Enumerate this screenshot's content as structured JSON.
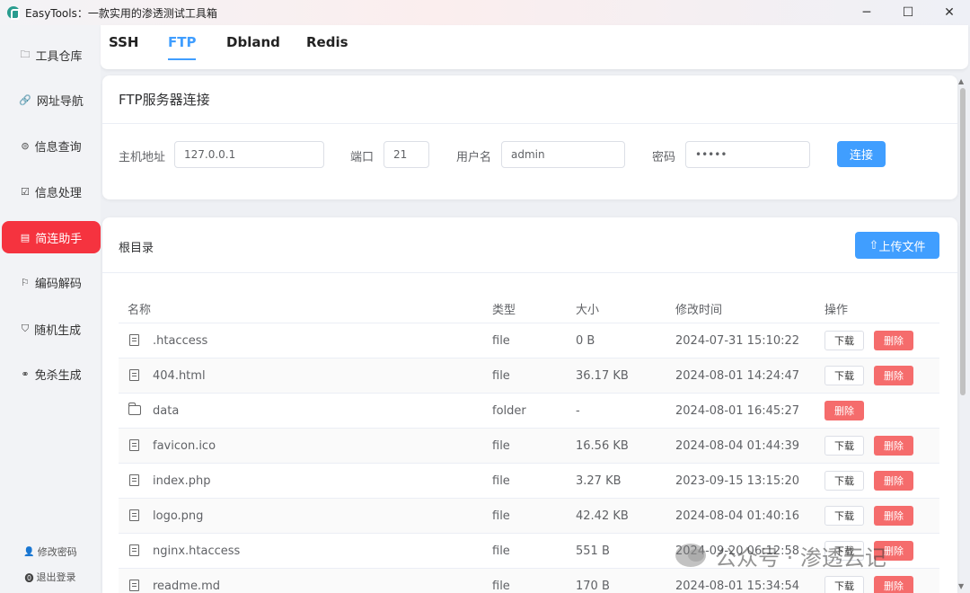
{
  "window": {
    "title": "EasyTools：一款实用的渗透测试工具箱",
    "controls": {
      "minimize": "─",
      "maximize": "☐",
      "close": "✕"
    }
  },
  "sidebar": {
    "items": [
      {
        "label": "工具仓库",
        "icon": "🗀"
      },
      {
        "label": "网址导航",
        "icon": "🔗"
      },
      {
        "label": "信息查询",
        "icon": "⊜"
      },
      {
        "label": "信息处理",
        "icon": "☑"
      },
      {
        "label": "简连助手",
        "icon": "▤",
        "active": true
      },
      {
        "label": "编码解码",
        "icon": "⚐"
      },
      {
        "label": "随机生成",
        "icon": "⛉"
      },
      {
        "label": "免杀生成",
        "icon": "⚭"
      }
    ],
    "footer": {
      "change_password": "修改密码",
      "change_password_icon": "👤",
      "logout": "退出登录",
      "logout_icon": "⓿"
    }
  },
  "tabs": [
    "SSH",
    "FTP",
    "Dbland",
    "Redis"
  ],
  "active_tab": "FTP",
  "connection": {
    "title": "FTP服务器连接",
    "host_label": "主机地址",
    "host_value": "127.0.0.1",
    "port_label": "端口",
    "port_value": "21",
    "user_label": "用户名",
    "user_value": "admin",
    "password_label": "密码",
    "password_value": "•••••",
    "connect_button": "连接"
  },
  "files": {
    "root_label": "根目录",
    "upload_button": "上传文件",
    "upload_icon": "⇧",
    "columns": {
      "name": "名称",
      "type": "类型",
      "size": "大小",
      "modified": "修改时间",
      "actions": "操作"
    },
    "download_label": "下载",
    "delete_label": "删除",
    "rows": [
      {
        "name": ".htaccess",
        "type": "file",
        "size": "0 B",
        "modified": "2024-07-31 15:10:22"
      },
      {
        "name": "404.html",
        "type": "file",
        "size": "36.17 KB",
        "modified": "2024-08-01 14:24:47"
      },
      {
        "name": "data",
        "type": "folder",
        "size": "-",
        "modified": "2024-08-01 16:45:27"
      },
      {
        "name": "favicon.ico",
        "type": "file",
        "size": "16.56 KB",
        "modified": "2024-08-04 01:44:39"
      },
      {
        "name": "index.php",
        "type": "file",
        "size": "3.27 KB",
        "modified": "2023-09-15 13:15:20"
      },
      {
        "name": "logo.png",
        "type": "file",
        "size": "42.42 KB",
        "modified": "2024-08-04 01:40:16"
      },
      {
        "name": "nginx.htaccess",
        "type": "file",
        "size": "551 B",
        "modified": "2024-09-20 06:12:58"
      },
      {
        "name": "readme.md",
        "type": "file",
        "size": "170 B",
        "modified": "2024-08-01 15:34:54"
      }
    ]
  },
  "watermark": "公众号 · 渗透云记",
  "colors": {
    "primary": "#409eff",
    "danger": "#f56c6c",
    "nav_active": "#f5333f"
  }
}
